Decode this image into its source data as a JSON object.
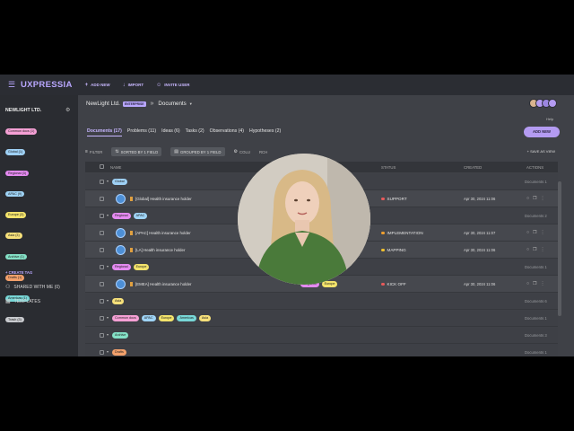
{
  "app": {
    "brand": "UXPRESSIA"
  },
  "topbar": {
    "add_new": "ADD NEW",
    "import": "IMPORT",
    "invite_user": "INVITE USER"
  },
  "sidebar": {
    "org": "NEWLIGHT LTD.",
    "tags": [
      {
        "label": "Common docs (1)",
        "color": "#f5a0d5"
      },
      {
        "label": "Global (1)",
        "color": "#9ed0f5"
      },
      {
        "label": "Regional (3)",
        "color": "#e48af0"
      },
      {
        "label": "APAC (9)",
        "color": "#9fd4f6"
      },
      {
        "label": "Europe (3)",
        "color": "#f3e36b"
      },
      {
        "label": "Asia (3)",
        "color": "#f6e07a"
      },
      {
        "label": "Archive (1)",
        "color": "#84e0c6"
      },
      {
        "label": "Drafts (1)",
        "color": "#f2a06b"
      },
      {
        "label": "Americas (1)",
        "color": "#78d7d7"
      },
      {
        "label": "Trash (3)",
        "color": "#c9cbcf"
      }
    ],
    "create_tag": "+ CREATE TAG",
    "shared": "SHARED WITH ME (0)",
    "templates": "TEMPLATES"
  },
  "header": {
    "project": "NewLight Ltd.",
    "badge": "ENTERPRISE",
    "section": "Documents",
    "help": "Help"
  },
  "tabs": [
    "Documents (17)",
    "Problems (11)",
    "Ideas (6)",
    "Tasks (2)",
    "Observations (4)",
    "Hypotheses (2)"
  ],
  "add_new_button": "ADD NEW",
  "toolbar": {
    "filter": "FILTER",
    "sorted": "SORTED BY 1 FIELD",
    "grouped": "GROUPED BY 1 FIELD",
    "columns": "COLU",
    "search": "RCH",
    "save_view": "SAVE AS VIEW"
  },
  "table": {
    "headers": {
      "name": "NAME",
      "status": "STATUS",
      "created": "CREATED",
      "actions": "ACTIONS"
    },
    "rows": [
      {
        "kind": "group",
        "tags": [
          {
            "label": "Global",
            "color": "#9ed0f5"
          }
        ],
        "count": "Documents 1"
      },
      {
        "kind": "item",
        "name": "[Global] Health insurance holder",
        "status": "SUPPORT",
        "status_color": "#e85a5a",
        "created": "Apr 30, 2024 11:06"
      },
      {
        "kind": "group",
        "tags": [
          {
            "label": "Regional",
            "color": "#e48af0"
          },
          {
            "label": "APAC",
            "color": "#9fd4f6"
          }
        ],
        "count": "Documents 2"
      },
      {
        "kind": "item",
        "name": "[APAC] Health insurance holder",
        "status": "IMPLEMENTATION",
        "status_color": "#f0a030",
        "created": "Apr 30, 2024 11:07"
      },
      {
        "kind": "item",
        "name": "[LA] Health insurance holder",
        "status": "MAPPING",
        "status_color": "#f0c030",
        "created": "Apr 30, 2024 11:06"
      },
      {
        "kind": "group",
        "tags": [
          {
            "label": "Regional",
            "color": "#e48af0"
          },
          {
            "label": "Europe",
            "color": "#f3e36b"
          }
        ],
        "count": "Documents 1"
      },
      {
        "kind": "item",
        "name": "[EMEA] Health insurance holder",
        "status": "KICK OFF",
        "status_color": "#e85a5a",
        "created": "Apr 30, 2024 11:06",
        "tags": [
          {
            "label": "Regional",
            "color": "#e48af0"
          },
          {
            "label": "Europe",
            "color": "#f3e36b"
          }
        ]
      },
      {
        "kind": "group",
        "tags": [
          {
            "label": "Asia",
            "color": "#f6e07a"
          }
        ],
        "count": "Documents 6"
      },
      {
        "kind": "group",
        "tags": [
          {
            "label": "Common docs",
            "color": "#f5a0d5"
          },
          {
            "label": "APAC",
            "color": "#9fd4f6"
          },
          {
            "label": "Europe",
            "color": "#f3e36b"
          },
          {
            "label": "Americas",
            "color": "#78d7d7"
          },
          {
            "label": "Asia",
            "color": "#f6e07a"
          }
        ],
        "count": "Documents 1"
      },
      {
        "kind": "group",
        "tags": [
          {
            "label": "Archive",
            "color": "#84e0c6"
          }
        ],
        "count": "Documents 3"
      },
      {
        "kind": "group",
        "tags": [
          {
            "label": "Drafts",
            "color": "#f2a06b"
          }
        ],
        "count": "Documents 1"
      }
    ]
  }
}
